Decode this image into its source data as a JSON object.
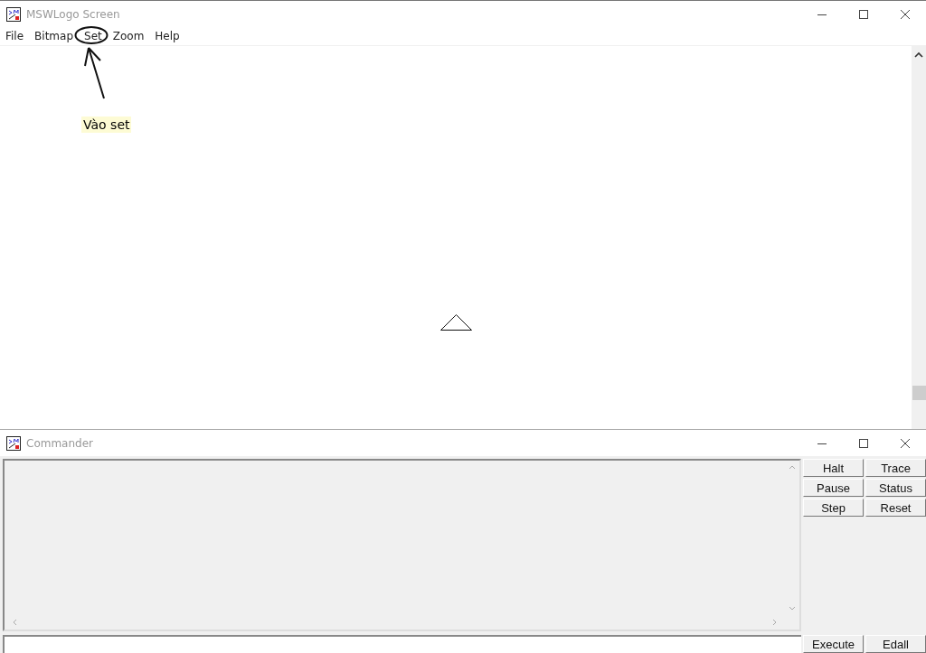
{
  "screen_window": {
    "title": "MSWLogo Screen",
    "menu": [
      {
        "label": "File",
        "circled": false
      },
      {
        "label": "Bitmap",
        "circled": false
      },
      {
        "label": "Set",
        "circled": true
      },
      {
        "label": "Zoom",
        "circled": false
      },
      {
        "label": "Help",
        "circled": false
      }
    ],
    "annotation": {
      "label": "Vào set"
    }
  },
  "commander": {
    "title": "Commander",
    "buttons": [
      {
        "label": "Halt"
      },
      {
        "label": "Trace"
      },
      {
        "label": "Pause"
      },
      {
        "label": "Status"
      },
      {
        "label": "Step"
      },
      {
        "label": "Reset"
      }
    ],
    "bottom_buttons": [
      {
        "label": "Execute"
      },
      {
        "label": "Edall"
      }
    ]
  }
}
